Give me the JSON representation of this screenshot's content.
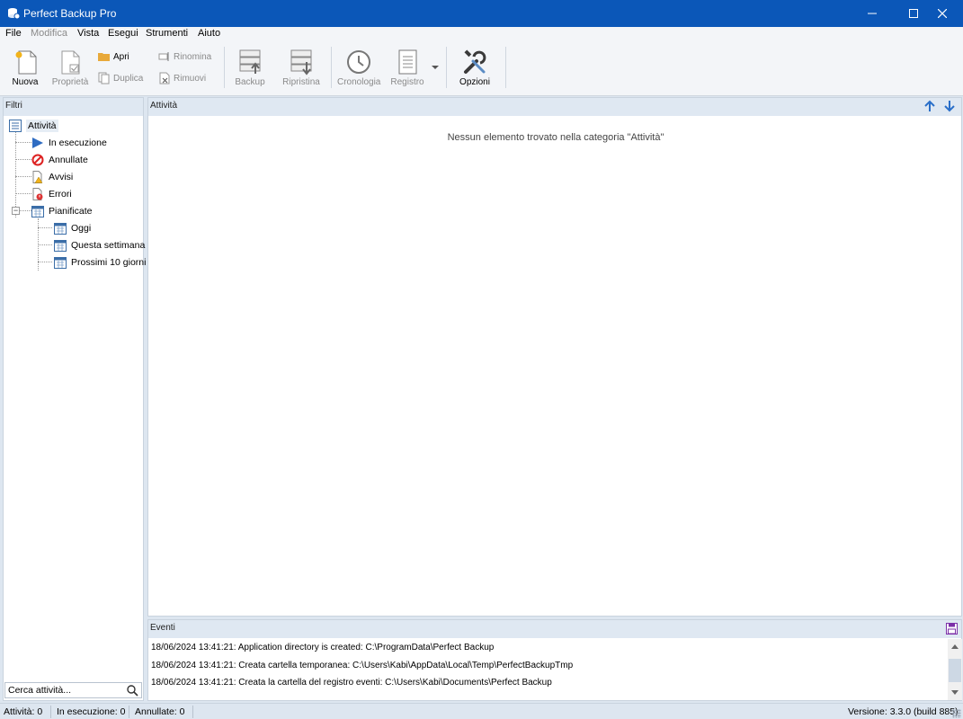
{
  "window": {
    "title": "Perfect Backup Pro"
  },
  "menu": [
    "File",
    "Modifica",
    "Vista",
    "Esegui",
    "Strumenti",
    "Aiuto"
  ],
  "toolbar": {
    "nuova": "Nuova",
    "proprieta": "Proprietà",
    "apri": "Apri",
    "duplica": "Duplica",
    "rinomina": "Rinomina",
    "rimuovi": "Rimuovi",
    "backup": "Backup",
    "ripristina": "Ripristina",
    "cronologia": "Cronologia",
    "registro": "Registro",
    "opzioni": "Opzioni"
  },
  "filters": {
    "header": "Filtri",
    "root": "Attività",
    "items": [
      "In esecuzione",
      "Annullate",
      "Avvisi",
      "Errori",
      "Pianificate"
    ],
    "scheduled": [
      "Oggi",
      "Questa settimana",
      "Prossimi 10 giorni"
    ],
    "search_placeholder": "Cerca attività..."
  },
  "main": {
    "header": "Attività",
    "empty_message": "Nessun elemento trovato nella categoria \"Attività\""
  },
  "events": {
    "header": "Eventi",
    "lines": [
      "18/06/2024 13:41:21: Application directory is created: C:\\ProgramData\\Perfect Backup",
      "18/06/2024 13:41:21: Creata cartella temporanea: C:\\Users\\Kabi\\AppData\\Local\\Temp\\PerfectBackupTmp",
      "18/06/2024 13:41:21: Creata la cartella del registro eventi: C:\\Users\\Kabi\\Documents\\Perfect Backup"
    ]
  },
  "status": {
    "activities": "Attività: 0",
    "running": "In esecuzione: 0",
    "cancelled": "Annullate: 0",
    "version": "Versione: 3.3.0 (build 885)"
  }
}
